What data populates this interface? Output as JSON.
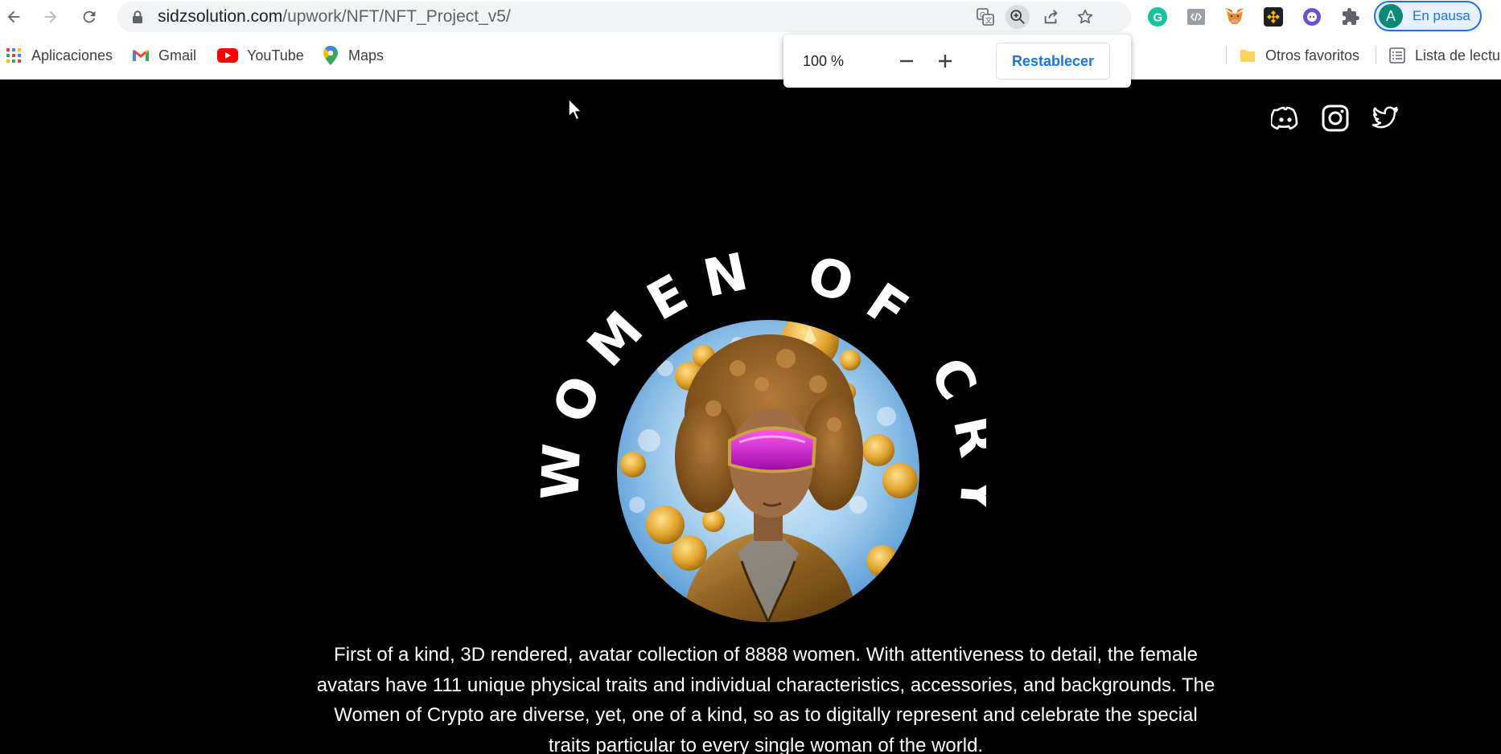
{
  "browser": {
    "url_domain": "sidzsolution.com",
    "url_path": "/upwork/NFT/NFT_Project_v5/",
    "profile_initial": "A",
    "profile_status": "En pausa",
    "accent_color": "#1a73e8"
  },
  "bookmarks": {
    "items": [
      {
        "label": "Aplicaciones",
        "icon": "apps-grid-icon"
      },
      {
        "label": "Gmail",
        "icon": "gmail-icon"
      },
      {
        "label": "YouTube",
        "icon": "youtube-icon"
      },
      {
        "label": "Maps",
        "icon": "maps-icon"
      }
    ],
    "other_favorites": "Otros favoritos",
    "reading_list": "Lista de lectu"
  },
  "zoom_popup": {
    "level": "100 %",
    "reset_label": "Restablecer"
  },
  "page": {
    "background": "#000000",
    "title_arc": "WOMEN OF CRYPTO",
    "social": [
      "discord-icon",
      "instagram-icon",
      "twitter-icon"
    ],
    "description": "First of a kind, 3D rendered, avatar collection of 8888 women. With attentiveness to detail, the female avatars have 111 unique physical traits and individual characteristics, accessories, and backgrounds. The Women of Crypto are diverse, yet, one of a kind, so as to digitally represent and celebrate the special traits particular to every single woman of the world."
  }
}
